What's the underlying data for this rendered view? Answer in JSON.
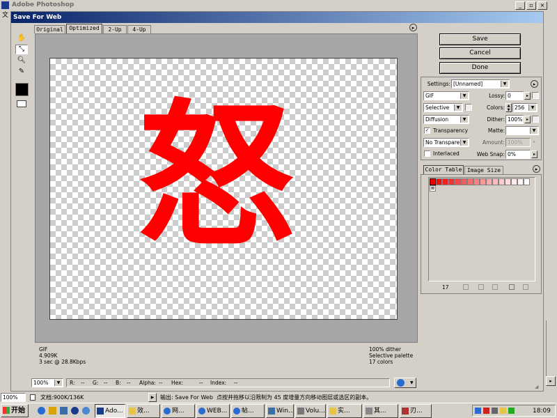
{
  "app": {
    "title": "Adobe Photoshop"
  },
  "dialog": {
    "title": "Save For Web"
  },
  "tabs": [
    "Original",
    "Optimized",
    "2-Up",
    "4-Up"
  ],
  "canvas": {
    "glyph": "怒",
    "glyph_color": "#ff0000"
  },
  "info_left": {
    "format": "GIF",
    "size": "4.909K",
    "time": "3 sec @ 28.8Kbps"
  },
  "info_right": {
    "dither": "100% dither",
    "palette": "Selective palette",
    "colors": "17 colors"
  },
  "buttons": {
    "save": "Save",
    "cancel": "Cancel",
    "done": "Done"
  },
  "settings": {
    "label": "Settings:",
    "value": "[Unnamed]",
    "format": "GIF",
    "reduction": "Selective",
    "dither_algo": "Diffusion",
    "transparency_label": "Transparency",
    "transparency_checked": true,
    "matte_dither": "No Transparen...",
    "interlaced_label": "Interlaced",
    "interlaced_checked": false,
    "lossy_label": "Lossy:",
    "lossy_value": "0",
    "colors_label": "Colors:",
    "colors_value": "256",
    "dither_label": "Dither:",
    "dither_value": "100%",
    "matte_label": "Matte:",
    "amount_label": "Amount:",
    "amount_value": "100%",
    "websnap_label": "Web Snap:",
    "websnap_value": "0%"
  },
  "color_panel": {
    "tabs": [
      "Color Table",
      "Image Size"
    ],
    "count": "17",
    "swatches": [
      "#ee0000",
      "#f01010",
      "#f22020",
      "#f43434",
      "#f54848",
      "#f65c5c",
      "#f77070",
      "#f88484",
      "#f99898",
      "#faaaaa",
      "#fbbcbc",
      "#fccccc",
      "#fddcdc",
      "#feeaea",
      "#fff4f4",
      "#ffffff"
    ]
  },
  "statusbar": {
    "zoom": "100%",
    "r": "R:",
    "g": "G:",
    "b": "B:",
    "alpha": "Alpha:",
    "hex": "Hex:",
    "index": "Index:",
    "dash": "--"
  },
  "ps_status": {
    "zoom": "100%",
    "doc": "文档:900K/136K",
    "output": "输出: Save For Web",
    "hint": "点按并拖移以沿限制为 45 度增量方向移动图层或选区的副本。"
  },
  "taskbar": {
    "start": "开始",
    "items": [
      "Ado...",
      "效...",
      "网...",
      "WEB...",
      "帖...",
      "Win...",
      "Volu...",
      "实...",
      "其...",
      "刃..."
    ],
    "clock": "18:09"
  },
  "menu_fragment": "文"
}
